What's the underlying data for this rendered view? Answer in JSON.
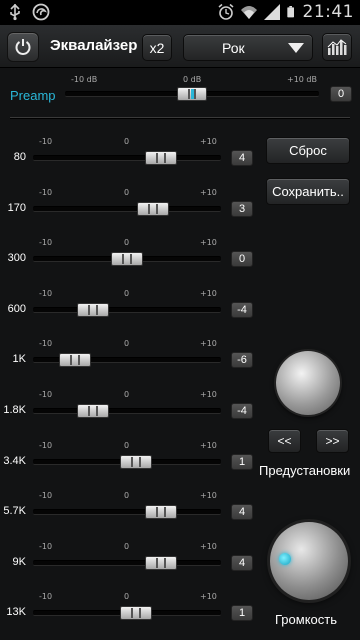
{
  "statusbar": {
    "time": "21:41"
  },
  "toolbar": {
    "title": "Эквалайзер",
    "x2_label": "x2",
    "preset_value": "Рок"
  },
  "preamp": {
    "label": "Preamp",
    "min_label": "-10 dB",
    "mid_label": "0 dB",
    "max_label": "+10 dB",
    "value": "0",
    "level": 0
  },
  "scale": {
    "min": "-10",
    "mid": "0",
    "max": "+10"
  },
  "bands": [
    {
      "freq": "80",
      "value": "4",
      "level": 4
    },
    {
      "freq": "170",
      "value": "3",
      "level": 3
    },
    {
      "freq": "300",
      "value": "0",
      "level": 0
    },
    {
      "freq": "600",
      "value": "-4",
      "level": -4
    },
    {
      "freq": "1K",
      "value": "-6",
      "level": -6
    },
    {
      "freq": "1.8K",
      "value": "-4",
      "level": -4
    },
    {
      "freq": "3.4K",
      "value": "1",
      "level": 1
    },
    {
      "freq": "5.7K",
      "value": "4",
      "level": 4
    },
    {
      "freq": "9K",
      "value": "4",
      "level": 4
    },
    {
      "freq": "13K",
      "value": "1",
      "level": 1
    }
  ],
  "actions": {
    "reset_label": "Сброс",
    "save_label": "Сохранить.."
  },
  "presets": {
    "prev_label": "<<",
    "next_label": ">>",
    "label": "Предустановки"
  },
  "volume": {
    "label": "Громкость"
  },
  "colors": {
    "accent": "#2ab7d8"
  }
}
